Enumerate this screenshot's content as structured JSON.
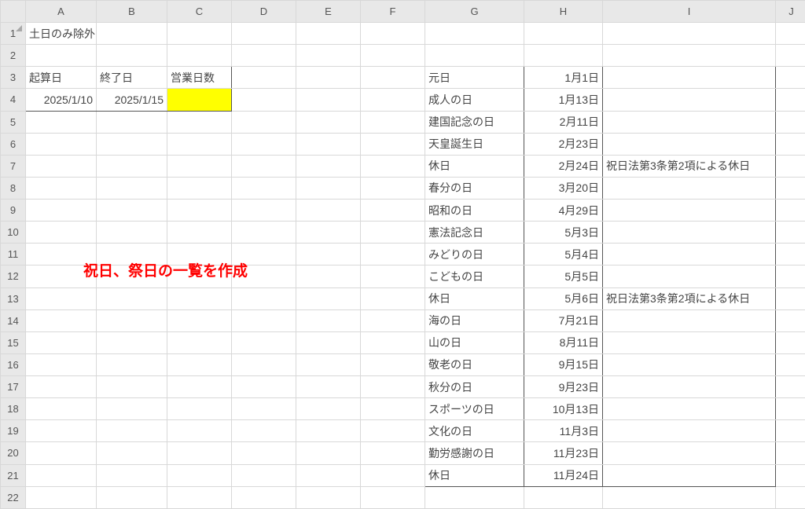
{
  "columns": [
    "A",
    "B",
    "C",
    "D",
    "E",
    "F",
    "G",
    "H",
    "I",
    "J"
  ],
  "rows": [
    1,
    2,
    3,
    4,
    5,
    6,
    7,
    8,
    9,
    10,
    11,
    12,
    13,
    14,
    15,
    16,
    17,
    18,
    19,
    20,
    21,
    22
  ],
  "title": "土日のみ除外",
  "headers": {
    "start": "起算日",
    "end": "終了日",
    "days": "営業日数"
  },
  "val": {
    "start": "2025/1/10",
    "end": "2025/1/15"
  },
  "note": "祝日、祭日の一覧を作成",
  "holidays": [
    {
      "name": "元日",
      "date": "1月1日",
      "note": ""
    },
    {
      "name": "成人の日",
      "date": "1月13日",
      "note": ""
    },
    {
      "name": "建国記念の日",
      "date": "2月11日",
      "note": ""
    },
    {
      "name": "天皇誕生日",
      "date": "2月23日",
      "note": ""
    },
    {
      "name": "休日",
      "date": "2月24日",
      "note": "祝日法第3条第2項による休日"
    },
    {
      "name": "春分の日",
      "date": "3月20日",
      "note": ""
    },
    {
      "name": "昭和の日",
      "date": "4月29日",
      "note": ""
    },
    {
      "name": "憲法記念日",
      "date": "5月3日",
      "note": ""
    },
    {
      "name": "みどりの日",
      "date": "5月4日",
      "note": ""
    },
    {
      "name": "こどもの日",
      "date": "5月5日",
      "note": ""
    },
    {
      "name": "休日",
      "date": "5月6日",
      "note": "祝日法第3条第2項による休日"
    },
    {
      "name": "海の日",
      "date": "7月21日",
      "note": ""
    },
    {
      "name": "山の日",
      "date": "8月11日",
      "note": ""
    },
    {
      "name": "敬老の日",
      "date": "9月15日",
      "note": ""
    },
    {
      "name": "秋分の日",
      "date": "9月23日",
      "note": ""
    },
    {
      "name": "スポーツの日",
      "date": "10月13日",
      "note": ""
    },
    {
      "name": "文化の日",
      "date": "11月3日",
      "note": ""
    },
    {
      "name": "勤労感謝の日",
      "date": "11月23日",
      "note": ""
    },
    {
      "name": "休日",
      "date": "11月24日",
      "note": ""
    }
  ]
}
